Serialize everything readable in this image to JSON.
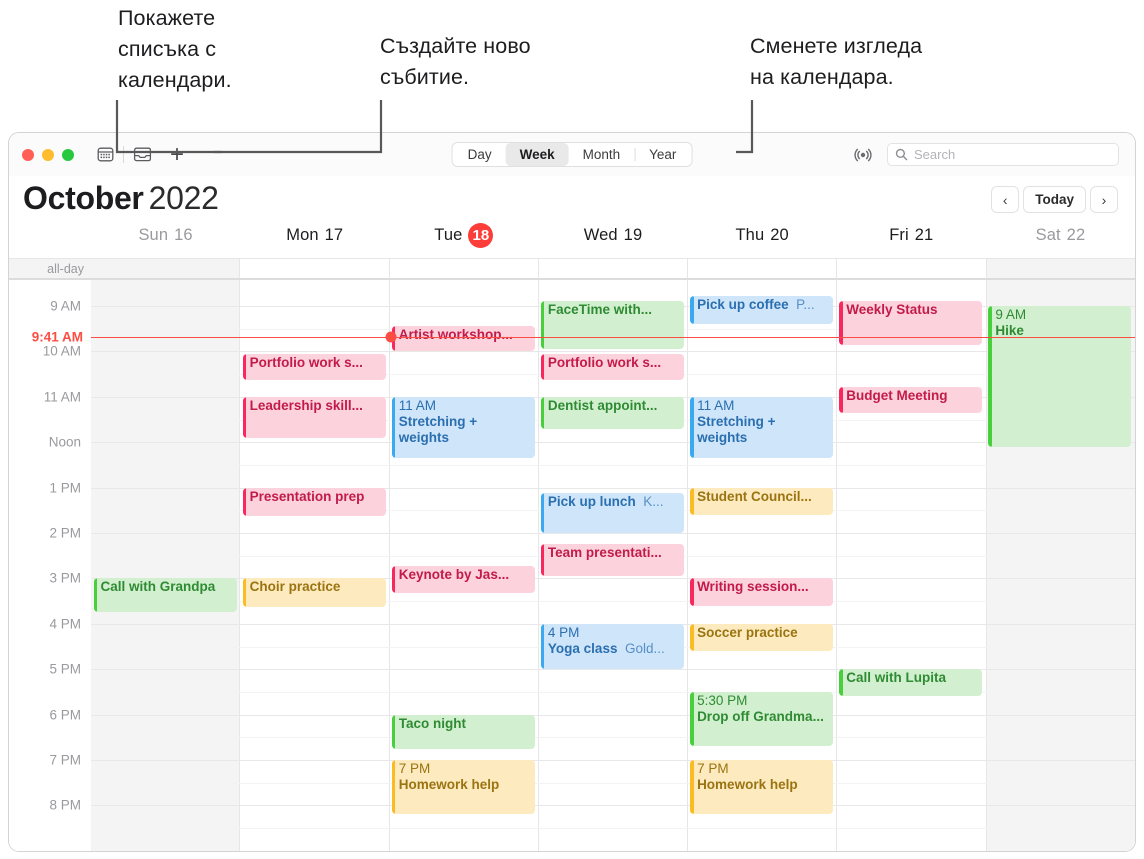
{
  "callouts": [
    {
      "id": "show-calendar-list",
      "text": "Покажете\nсписъка с\nкалендари."
    },
    {
      "id": "create-new-event",
      "text": "Създайте ново\nсъбитие."
    },
    {
      "id": "change-calendar-view",
      "text": "Сменете изгледа\nна календара."
    }
  ],
  "toolbar": {
    "calendar_list_icon": "calendar-icon",
    "inbox_icon": "inbox-icon",
    "add_label": "+",
    "views": [
      {
        "label": "Day",
        "active": false
      },
      {
        "label": "Week",
        "active": true
      },
      {
        "label": "Month",
        "active": false
      },
      {
        "label": "Year",
        "active": false
      }
    ],
    "broadcast_icon": "broadcast-icon",
    "search": {
      "icon": "search-icon",
      "placeholder": "Search",
      "value": ""
    }
  },
  "header": {
    "month": "October",
    "year": "2022",
    "prev_label": "‹",
    "today_label": "Today",
    "next_label": "›"
  },
  "days": [
    {
      "name": "Sun",
      "num": "16",
      "dim": true,
      "today": false
    },
    {
      "name": "Mon",
      "num": "17",
      "dim": false,
      "today": false
    },
    {
      "name": "Tue",
      "num": "18",
      "dim": false,
      "today": true
    },
    {
      "name": "Wed",
      "num": "19",
      "dim": false,
      "today": false
    },
    {
      "name": "Thu",
      "num": "20",
      "dim": false,
      "today": false
    },
    {
      "name": "Fri",
      "num": "21",
      "dim": false,
      "today": false
    },
    {
      "name": "Sat",
      "num": "22",
      "dim": true,
      "today": false
    }
  ],
  "allday_label": "all-day",
  "hours": [
    {
      "label": "9 AM",
      "hour": 9
    },
    {
      "label": "10 AM",
      "hour": 10
    },
    {
      "label": "11 AM",
      "hour": 11
    },
    {
      "label": "Noon",
      "hour": 12
    },
    {
      "label": "1 PM",
      "hour": 13
    },
    {
      "label": "2 PM",
      "hour": 14
    },
    {
      "label": "3 PM",
      "hour": 15
    },
    {
      "label": "4 PM",
      "hour": 16
    },
    {
      "label": "5 PM",
      "hour": 17
    },
    {
      "label": "6 PM",
      "hour": 18
    },
    {
      "label": "7 PM",
      "hour": 19
    },
    {
      "label": "8 PM",
      "hour": 20
    }
  ],
  "now": {
    "label": "9:41 AM",
    "hour": 9.68,
    "day_index": 2
  },
  "colors": {
    "pink": "#f8285f",
    "green": "#48d03c",
    "blue": "#3aaaf0",
    "yellow": "#fbbb22",
    "today_badge": "#fc3d39",
    "now_line": "#fb4d44"
  },
  "events": [
    {
      "day": 0,
      "start": 15.0,
      "end": 15.75,
      "title": "Call with Grandpa",
      "time": "",
      "loc": "",
      "color": "green"
    },
    {
      "day": 1,
      "start": 10.05,
      "end": 10.62,
      "title": "Portfolio work s...",
      "time": "",
      "loc": "",
      "color": "pink"
    },
    {
      "day": 1,
      "start": 11.0,
      "end": 11.9,
      "title": "Leadership skill...",
      "time": "",
      "loc": "",
      "color": "pink"
    },
    {
      "day": 1,
      "start": 13.0,
      "end": 13.62,
      "title": "Presentation prep",
      "time": "",
      "loc": "",
      "color": "pink"
    },
    {
      "day": 1,
      "start": 15.0,
      "end": 15.62,
      "title": "Choir practice",
      "time": "",
      "loc": "",
      "color": "yellow"
    },
    {
      "day": 2,
      "start": 9.45,
      "end": 10.0,
      "title": "Artist workshop...",
      "time": "",
      "loc": "",
      "color": "pink"
    },
    {
      "day": 2,
      "start": 11.0,
      "end": 12.35,
      "title": "Stretching + weights",
      "time": "11 AM",
      "loc": "",
      "color": "blue"
    },
    {
      "day": 2,
      "start": 14.72,
      "end": 15.32,
      "title": "Keynote by Jas...",
      "time": "",
      "loc": "",
      "color": "pink"
    },
    {
      "day": 2,
      "start": 18.0,
      "end": 18.75,
      "title": "Taco night",
      "time": "",
      "loc": "",
      "color": "green"
    },
    {
      "day": 2,
      "start": 19.0,
      "end": 20.2,
      "title": "Homework help",
      "time": "7 PM",
      "loc": "",
      "color": "yellow"
    },
    {
      "day": 3,
      "start": 8.9,
      "end": 9.95,
      "title": "FaceTime with...",
      "time": "",
      "loc": "",
      "color": "green"
    },
    {
      "day": 3,
      "start": 10.05,
      "end": 10.62,
      "title": "Portfolio work s...",
      "time": "",
      "loc": "",
      "color": "pink"
    },
    {
      "day": 3,
      "start": 11.0,
      "end": 11.72,
      "title": "Dentist appoint...",
      "time": "",
      "loc": "",
      "color": "green"
    },
    {
      "day": 3,
      "start": 13.12,
      "end": 14.0,
      "title": "Pick up lunch",
      "time": "",
      "loc": "K...",
      "color": "blue"
    },
    {
      "day": 3,
      "start": 14.25,
      "end": 14.95,
      "title": "Team presentati...",
      "time": "",
      "loc": "",
      "color": "pink"
    },
    {
      "day": 3,
      "start": 16.0,
      "end": 17.0,
      "title": "Yoga class",
      "time": "4 PM",
      "loc": "Gold...",
      "color": "blue"
    },
    {
      "day": 4,
      "start": 8.78,
      "end": 9.4,
      "title": "Pick up coffee",
      "time": "",
      "loc": "P...",
      "color": "blue"
    },
    {
      "day": 4,
      "start": 11.0,
      "end": 12.35,
      "title": "Stretching + weights",
      "time": "11 AM",
      "loc": "",
      "color": "blue"
    },
    {
      "day": 4,
      "start": 13.0,
      "end": 13.6,
      "title": "Student Council...",
      "time": "",
      "loc": "",
      "color": "yellow"
    },
    {
      "day": 4,
      "start": 15.0,
      "end": 15.6,
      "title": "Writing session...",
      "time": "",
      "loc": "",
      "color": "pink"
    },
    {
      "day": 4,
      "start": 16.0,
      "end": 16.6,
      "title": "Soccer practice",
      "time": "",
      "loc": "",
      "color": "yellow"
    },
    {
      "day": 4,
      "start": 17.5,
      "end": 18.7,
      "title": "Drop off Grandma...",
      "time": "5:30 PM",
      "loc": "",
      "color": "green"
    },
    {
      "day": 4,
      "start": 19.0,
      "end": 20.2,
      "title": "Homework help",
      "time": "7 PM",
      "loc": "",
      "color": "yellow"
    },
    {
      "day": 5,
      "start": 8.88,
      "end": 9.85,
      "title": "Weekly Status",
      "time": "",
      "loc": "",
      "color": "pink"
    },
    {
      "day": 5,
      "start": 10.78,
      "end": 11.35,
      "title": "Budget Meeting",
      "time": "",
      "loc": "",
      "color": "pink"
    },
    {
      "day": 5,
      "start": 17.0,
      "end": 17.6,
      "title": "Call with Lupita",
      "time": "",
      "loc": "",
      "color": "green"
    },
    {
      "day": 6,
      "start": 9.0,
      "end": 12.1,
      "title": "Hike",
      "time": "9 AM",
      "loc": "",
      "color": "green"
    }
  ]
}
